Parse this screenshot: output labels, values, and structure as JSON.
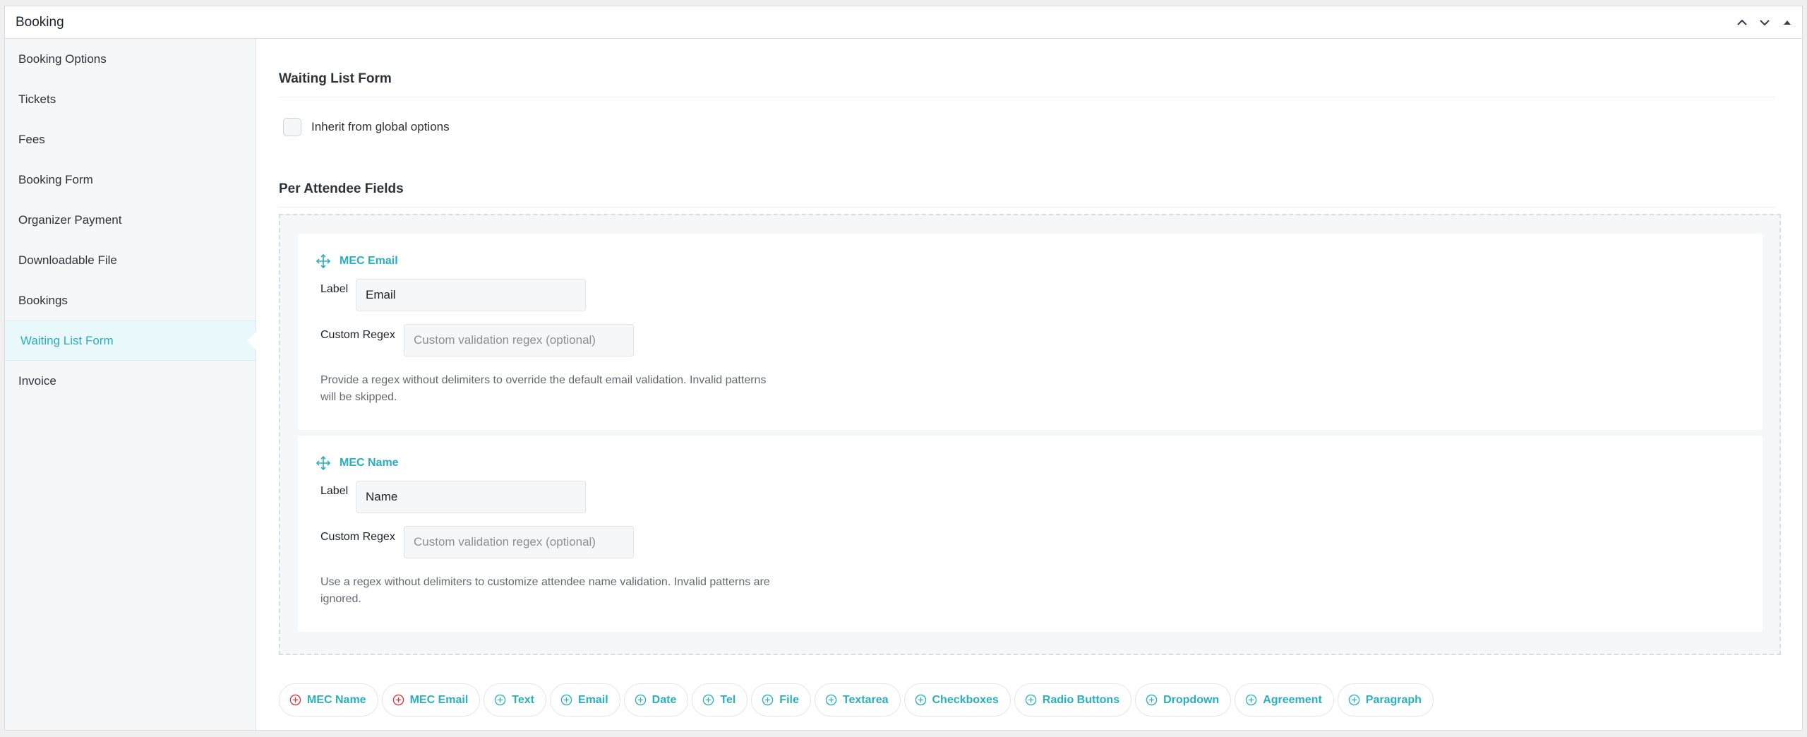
{
  "panel": {
    "title": "Booking"
  },
  "sidebar": {
    "items": [
      {
        "label": "Booking Options"
      },
      {
        "label": "Tickets"
      },
      {
        "label": "Fees"
      },
      {
        "label": "Booking Form"
      },
      {
        "label": "Organizer Payment"
      },
      {
        "label": "Downloadable File"
      },
      {
        "label": "Bookings"
      },
      {
        "label": "Waiting List Form",
        "active": true
      },
      {
        "label": "Invoice"
      }
    ]
  },
  "main": {
    "section_title": "Waiting List Form",
    "inherit_label": "Inherit from global options",
    "fields_title": "Per Attendee Fields",
    "fields": [
      {
        "title": "MEC Email",
        "label_caption": "Label",
        "label_value": "Email",
        "regex_caption": "Custom Regex",
        "regex_placeholder": "Custom validation regex (optional)",
        "description": "Provide a regex without delimiters to override the default email validation. Invalid patterns will be skipped."
      },
      {
        "title": "MEC Name",
        "label_caption": "Label",
        "label_value": "Name",
        "regex_caption": "Custom Regex",
        "regex_placeholder": "Custom validation regex (optional)",
        "description": "Use a regex without delimiters to customize attendee name validation. Invalid patterns are ignored."
      }
    ],
    "add_buttons": [
      {
        "label": "MEC Name",
        "icon": "remove-circle-icon"
      },
      {
        "label": "MEC Email",
        "icon": "remove-circle-icon"
      },
      {
        "label": "Text",
        "icon": "add-circle-icon"
      },
      {
        "label": "Email",
        "icon": "add-circle-icon"
      },
      {
        "label": "Date",
        "icon": "add-circle-icon"
      },
      {
        "label": "Tel",
        "icon": "add-circle-icon"
      },
      {
        "label": "File",
        "icon": "add-circle-icon"
      },
      {
        "label": "Textarea",
        "icon": "add-circle-icon"
      },
      {
        "label": "Checkboxes",
        "icon": "add-circle-icon"
      },
      {
        "label": "Radio Buttons",
        "icon": "add-circle-icon"
      },
      {
        "label": "Dropdown",
        "icon": "add-circle-icon"
      },
      {
        "label": "Agreement",
        "icon": "add-circle-icon"
      },
      {
        "label": "Paragraph",
        "icon": "add-circle-icon"
      }
    ]
  },
  "colors": {
    "accent": "#2aaec0",
    "remove": "#d63638",
    "sidebar_bg": "#f6f7f9",
    "active_bg": "#e9f8fb"
  }
}
